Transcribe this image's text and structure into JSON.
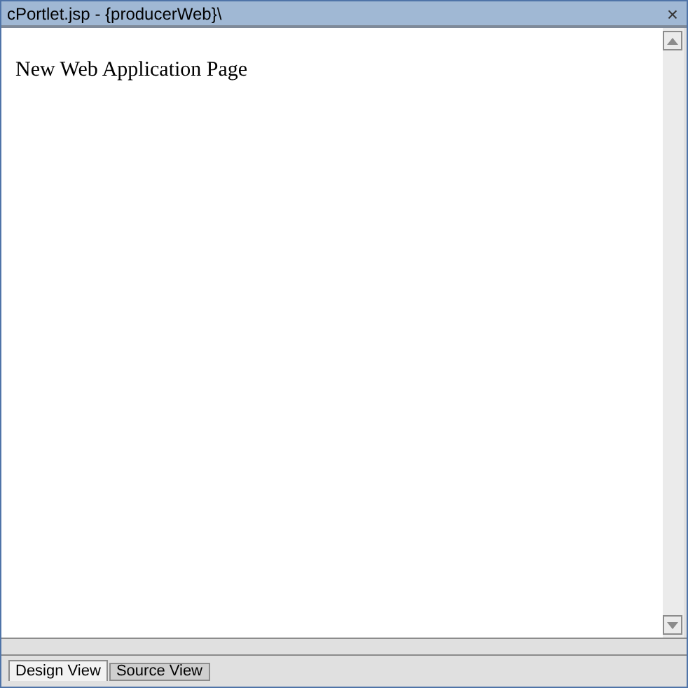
{
  "window": {
    "title": "cPortlet.jsp - {producerWeb}\\",
    "close": "×"
  },
  "page": {
    "heading": "New Web Application Page"
  },
  "tabs": [
    {
      "label": "Design View",
      "selected": true
    },
    {
      "label": "Source View",
      "selected": false
    }
  ]
}
